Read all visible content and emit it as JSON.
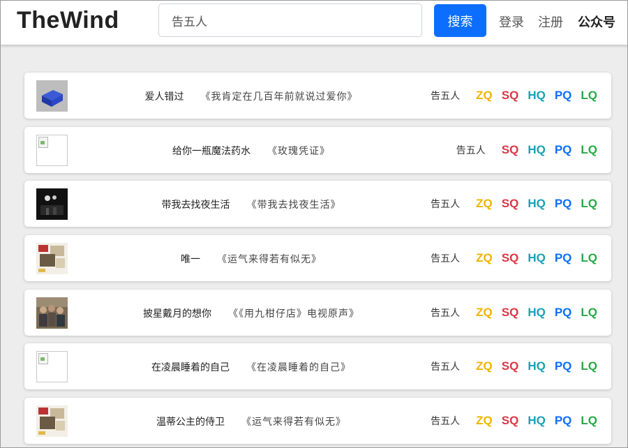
{
  "brand": "TheWind",
  "search": {
    "value": "告五人",
    "button_label": "搜索"
  },
  "nav": {
    "login": "登录",
    "register": "注册",
    "wechat": "公众号"
  },
  "quality_colors": {
    "ZQ": "#f0b400",
    "SQ": "#dc3545",
    "HQ": "#17a2b8",
    "PQ": "#0d6efd",
    "LQ": "#28a745"
  },
  "songs": [
    {
      "title": "爱人错过",
      "album": "《我肯定在几百年前就说过爱你》",
      "artist": "告五人",
      "qualities": [
        "ZQ",
        "SQ",
        "HQ",
        "PQ",
        "LQ"
      ],
      "thumb": "blue-cube"
    },
    {
      "title": "给你一瓶魔法药水",
      "album": "《玫瑰凭证》",
      "artist": "告五人",
      "qualities": [
        "SQ",
        "HQ",
        "PQ",
        "LQ"
      ],
      "thumb": "broken"
    },
    {
      "title": "带我去找夜生活",
      "album": "《带我去找夜生活》",
      "artist": "告五人",
      "qualities": [
        "ZQ",
        "SQ",
        "HQ",
        "PQ",
        "LQ"
      ],
      "thumb": "dark"
    },
    {
      "title": "唯一",
      "album": "《运气来得若有似无》",
      "artist": "告五人",
      "qualities": [
        "ZQ",
        "SQ",
        "HQ",
        "PQ",
        "LQ"
      ],
      "thumb": "collage"
    },
    {
      "title": "披星戴月的想你",
      "album": "《《用九柑仔店》电视原声》",
      "artist": "告五人",
      "qualities": [
        "ZQ",
        "SQ",
        "HQ",
        "PQ",
        "LQ"
      ],
      "thumb": "photo"
    },
    {
      "title": "在凌晨睡着的自己",
      "album": "《在凌晨睡着的自己》",
      "artist": "告五人",
      "qualities": [
        "ZQ",
        "SQ",
        "HQ",
        "PQ",
        "LQ"
      ],
      "thumb": "broken"
    },
    {
      "title": "温蒂公主的侍卫",
      "album": "《运气来得若有似无》",
      "artist": "告五人",
      "qualities": [
        "ZQ",
        "SQ",
        "HQ",
        "PQ",
        "LQ"
      ],
      "thumb": "collage"
    }
  ]
}
